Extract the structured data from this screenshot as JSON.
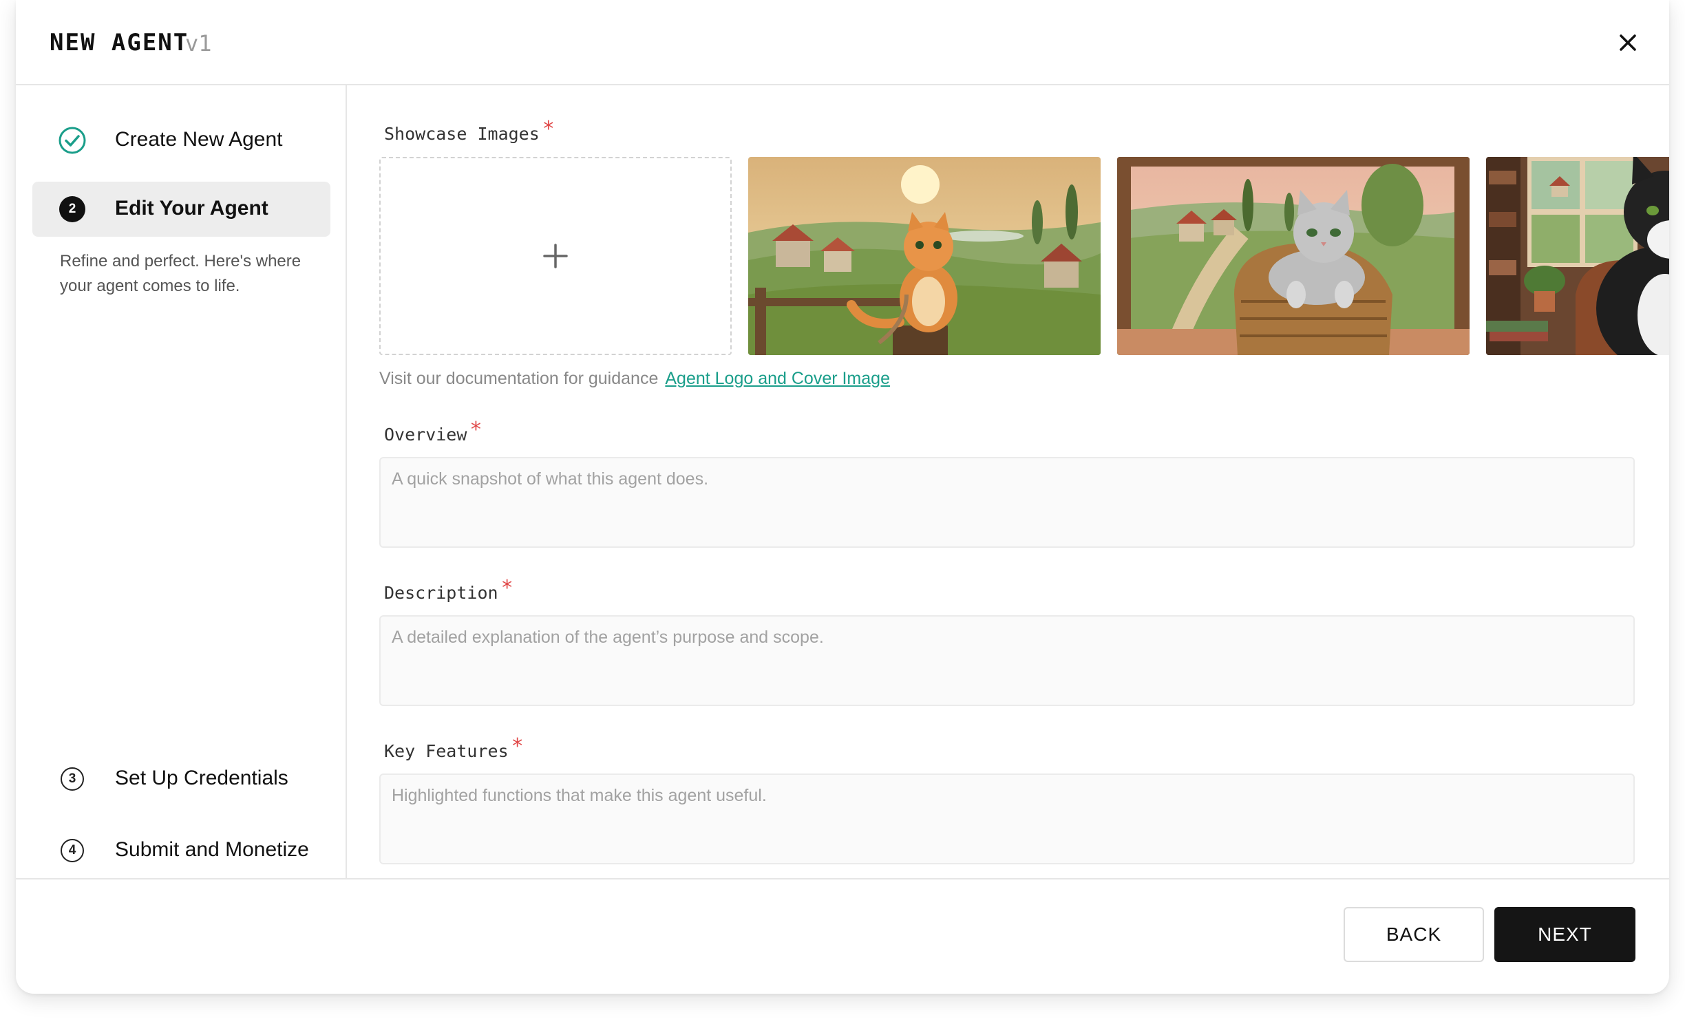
{
  "header": {
    "title": "NEW AGENT",
    "version": "v1",
    "close_icon": "close-icon"
  },
  "sidebar": {
    "steps": [
      {
        "label": "Create New Agent",
        "status": "completed",
        "icon": "check-circle-icon"
      },
      {
        "label": "Edit Your Agent",
        "status": "active",
        "number": "2"
      },
      {
        "label": "Set Up Credentials",
        "status": "pending",
        "number": "3"
      },
      {
        "label": "Submit and Monetize",
        "status": "pending",
        "number": "4"
      }
    ],
    "active_description": "Refine and perfect. Here's where your agent comes to life."
  },
  "form": {
    "showcase": {
      "label": "Showcase Images",
      "required_mark": "*",
      "upload_icon": "plus-icon",
      "images": [
        "orange-cat-countryside-image",
        "gray-cat-basket-image",
        "tuxedo-cat-study-image"
      ],
      "guidance_text": "Visit our documentation for guidance",
      "guidance_link": "Agent Logo and Cover Image"
    },
    "overview": {
      "label": "Overview",
      "required_mark": "*",
      "placeholder": "A quick snapshot of what this agent does."
    },
    "description": {
      "label": "Description",
      "required_mark": "*",
      "placeholder": "A detailed explanation of the agent’s purpose and scope."
    },
    "key_features": {
      "label": "Key Features",
      "required_mark": "*",
      "placeholder": "Highlighted functions that make this agent useful."
    }
  },
  "footer": {
    "back_label": "BACK",
    "next_label": "NEXT"
  },
  "colors": {
    "accent_teal": "#1a9e8a",
    "required_red": "#e04848",
    "primary_button": "#151515",
    "active_step_bg": "#ededed"
  }
}
